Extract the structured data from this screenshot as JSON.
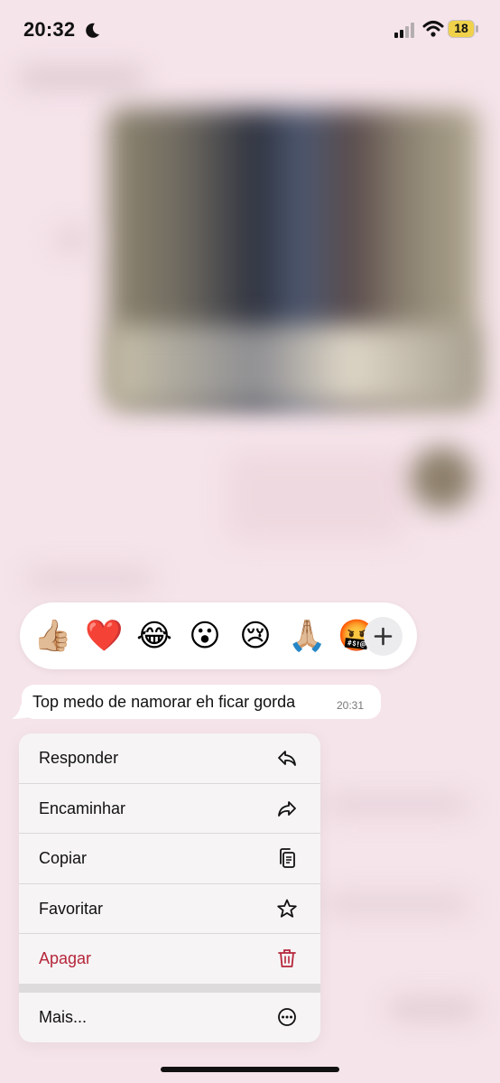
{
  "status_bar": {
    "time": "20:32",
    "battery": "18",
    "focus_icon": "moon-icon",
    "signal_icon": "cellular-signal-icon",
    "wifi_icon": "wifi-icon"
  },
  "reactions": {
    "items": [
      {
        "emoji": "👍🏼",
        "name": "thumbs-up"
      },
      {
        "emoji": "❤️",
        "name": "red-heart"
      },
      {
        "emoji": "😂",
        "name": "tears-of-joy"
      },
      {
        "emoji": "😮",
        "name": "surprised"
      },
      {
        "emoji": "😢",
        "name": "crying"
      },
      {
        "emoji": "🙏🏼",
        "name": "folded-hands"
      },
      {
        "emoji": "🤬",
        "name": "partial-emoji"
      }
    ],
    "more_icon": "plus-icon"
  },
  "message": {
    "text": "Top medo de namorar eh ficar gorda",
    "time": "20:31"
  },
  "menu": {
    "items": [
      {
        "label": "Responder",
        "icon": "reply-icon"
      },
      {
        "label": "Encaminhar",
        "icon": "forward-icon"
      },
      {
        "label": "Copiar",
        "icon": "copy-icon"
      },
      {
        "label": "Favoritar",
        "icon": "star-icon"
      },
      {
        "label": "Apagar",
        "icon": "trash-icon",
        "color": "#b5263a"
      },
      {
        "label": "Mais...",
        "icon": "more-icon"
      }
    ]
  }
}
